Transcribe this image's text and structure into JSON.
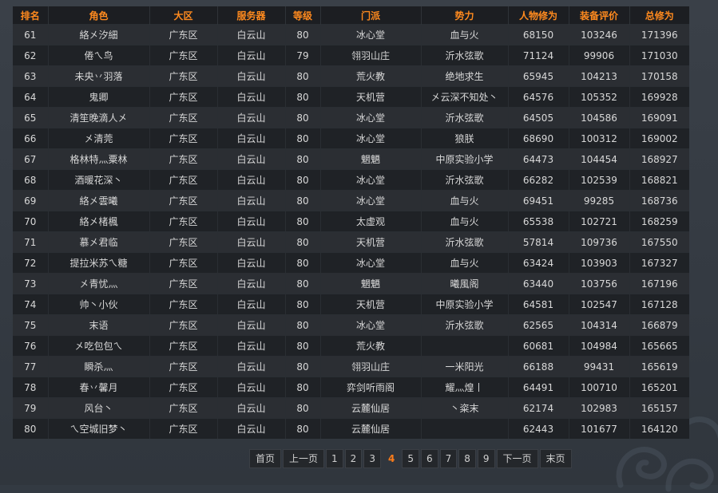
{
  "table": {
    "headers": [
      "排名",
      "角色",
      "大区",
      "服务器",
      "等级",
      "门派",
      "势力",
      "人物修为",
      "装备评价",
      "总修为"
    ],
    "rows": [
      [
        "61",
        "絡㐅汐細",
        "广东区",
        "白云山",
        "80",
        "冰心堂",
        "血与火",
        "68150",
        "103246",
        "171396"
      ],
      [
        "62",
        "倦ㄟ鸟",
        "广东区",
        "白云山",
        "79",
        "翎羽山庄",
        "沂水弦歌",
        "71124",
        "99906",
        "171030"
      ],
      [
        "63",
        "未央丷羽落",
        "广东区",
        "白云山",
        "80",
        "荒火教",
        "绝地求生",
        "65945",
        "104213",
        "170158"
      ],
      [
        "64",
        "鬼卿",
        "广东区",
        "白云山",
        "80",
        "天机营",
        "㐅云深不知处丶",
        "64576",
        "105352",
        "169928"
      ],
      [
        "65",
        "清笙晚滴人㐅",
        "广东区",
        "白云山",
        "80",
        "冰心堂",
        "沂水弦歌",
        "64505",
        "104586",
        "169091"
      ],
      [
        "66",
        "㐅清莞",
        "广东区",
        "白云山",
        "80",
        "冰心堂",
        "狼朕",
        "68690",
        "100312",
        "169002"
      ],
      [
        "67",
        "格林特灬粟林",
        "广东区",
        "白云山",
        "80",
        "魍魉",
        "中原实验小学",
        "64473",
        "104454",
        "168927"
      ],
      [
        "68",
        "酒暖花深丶",
        "广东区",
        "白云山",
        "80",
        "冰心堂",
        "沂水弦歌",
        "66282",
        "102539",
        "168821"
      ],
      [
        "69",
        "絡㐅雲曦",
        "广东区",
        "白云山",
        "80",
        "冰心堂",
        "血与火",
        "69451",
        "99285",
        "168736"
      ],
      [
        "70",
        "絡㐅楮楓",
        "广东区",
        "白云山",
        "80",
        "太虚观",
        "血与火",
        "65538",
        "102721",
        "168259"
      ],
      [
        "71",
        "慕㐅君临",
        "广东区",
        "白云山",
        "80",
        "天机营",
        "沂水弦歌",
        "57814",
        "109736",
        "167550"
      ],
      [
        "72",
        "提拉米苏ㄟ糖",
        "广东区",
        "白云山",
        "80",
        "冰心堂",
        "血与火",
        "63424",
        "103903",
        "167327"
      ],
      [
        "73",
        "㐅青忧灬",
        "广东区",
        "白云山",
        "80",
        "魍魉",
        "曦風阁",
        "63440",
        "103756",
        "167196"
      ],
      [
        "74",
        "帅丶小伙",
        "广东区",
        "白云山",
        "80",
        "天机营",
        "中原实验小学",
        "64581",
        "102547",
        "167128"
      ],
      [
        "75",
        "末语",
        "广东区",
        "白云山",
        "80",
        "冰心堂",
        "沂水弦歌",
        "62565",
        "104314",
        "166879"
      ],
      [
        "76",
        "㐅吃包包ㄟ",
        "广东区",
        "白云山",
        "80",
        "荒火教",
        "",
        "60681",
        "104984",
        "165665"
      ],
      [
        "77",
        "瞬杀灬",
        "广东区",
        "白云山",
        "80",
        "翎羽山庄",
        "一米阳光",
        "66188",
        "99431",
        "165619"
      ],
      [
        "78",
        "春丷馨月",
        "广东区",
        "白云山",
        "80",
        "弈剑听雨阁",
        "耀灬煌丨",
        "64491",
        "100710",
        "165201"
      ],
      [
        "79",
        "风台丶",
        "广东区",
        "白云山",
        "80",
        "云麓仙居",
        "丶粢末",
        "62174",
        "102983",
        "165157"
      ],
      [
        "80",
        "ㄟ空城旧梦丶",
        "广东区",
        "白云山",
        "80",
        "云麓仙居",
        "",
        "62443",
        "101677",
        "164120"
      ]
    ]
  },
  "pagination": {
    "first": "首页",
    "prev": "上一页",
    "pages_before": [
      "1",
      "2",
      "3"
    ],
    "current": "4",
    "pages_after": [
      "5",
      "6",
      "7",
      "8",
      "9"
    ],
    "next": "下一页",
    "last": "末页"
  },
  "colors": {
    "header_text": "#ff8a1e",
    "current_page": "#ff7d1a"
  }
}
